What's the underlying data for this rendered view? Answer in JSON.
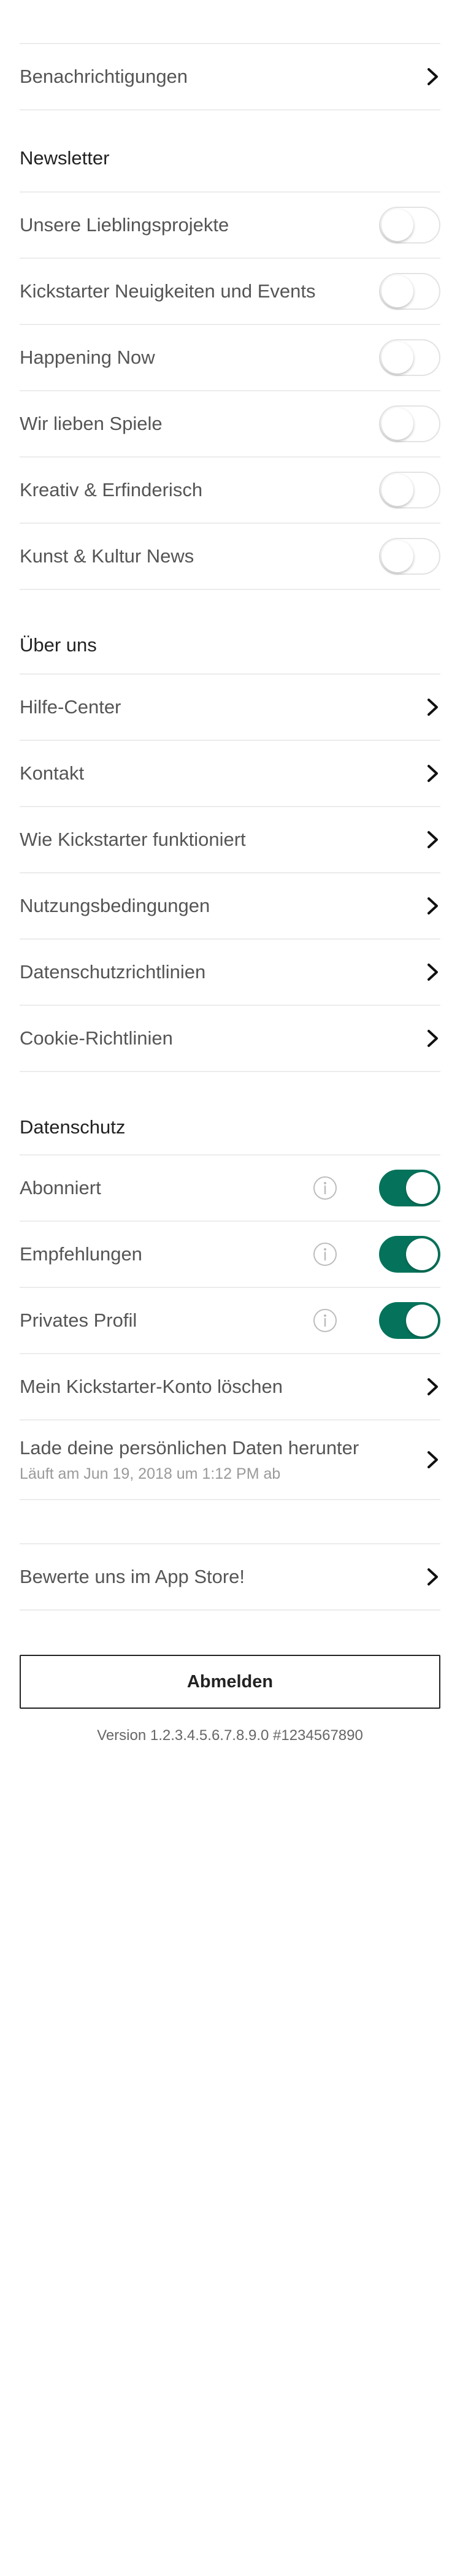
{
  "account": {
    "notifications_label": "Benachrichtigungen"
  },
  "newsletter": {
    "header": "Newsletter",
    "items": [
      {
        "label": "Unsere Lieblingsprojekte",
        "on": false
      },
      {
        "label": "Kickstarter Neuigkeiten und Events",
        "on": false
      },
      {
        "label": "Happening Now",
        "on": false
      },
      {
        "label": "Wir lieben Spiele",
        "on": false
      },
      {
        "label": "Kreativ & Erfinderisch",
        "on": false
      },
      {
        "label": "Kunst & Kultur News",
        "on": false
      }
    ]
  },
  "about": {
    "header": "Über uns",
    "items": [
      {
        "label": "Hilfe-Center"
      },
      {
        "label": "Kontakt"
      },
      {
        "label": "Wie Kickstarter funktioniert"
      },
      {
        "label": "Nutzungsbedingungen"
      },
      {
        "label": "Datenschutzrichtlinien"
      },
      {
        "label": "Cookie-Richtlinien"
      }
    ]
  },
  "privacy": {
    "header": "Datenschutz",
    "toggles": [
      {
        "label": "Abonniert",
        "on": true
      },
      {
        "label": "Empfehlungen",
        "on": true
      },
      {
        "label": "Privates Profil",
        "on": true
      }
    ],
    "delete_account_label": "Mein Kickstarter-Konto löschen",
    "download_label": "Lade deine persönlichen Daten herunter",
    "download_sub": "Läuft am Jun 19, 2018 um 1:12 PM ab"
  },
  "rate": {
    "label": "Bewerte uns im App Store!"
  },
  "logout_label": "Abmelden",
  "version": "Version 1.2.3.4.5.6.7.8.9.0 #1234567890",
  "colors": {
    "toggle_on": "#05735b",
    "divider": "#ececec"
  },
  "icons": {
    "chevron": "chevron-right-icon",
    "info": "info-icon"
  }
}
